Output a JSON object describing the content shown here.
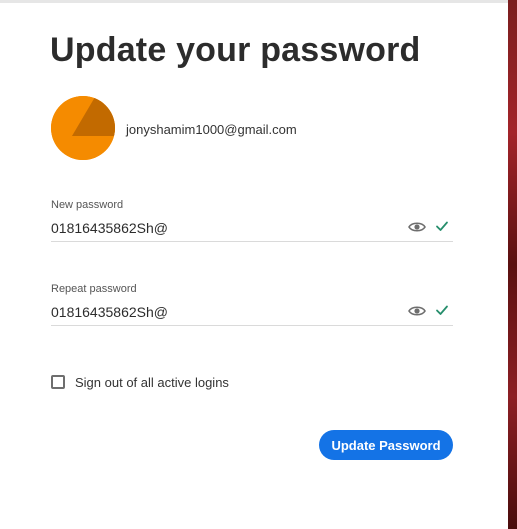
{
  "page": {
    "title": "Update your password"
  },
  "account": {
    "email": "jonyshamim1000@gmail.com",
    "avatar_color": "#f58b00"
  },
  "new_password": {
    "label": "New password",
    "value": "01816435862Sh@",
    "show_icon": "eye-icon",
    "valid_icon": "check-icon",
    "valid_color": "#268e6c"
  },
  "repeat_password": {
    "label": "Repeat password",
    "value": "01816435862Sh@",
    "show_icon": "eye-icon",
    "valid_icon": "check-icon",
    "valid_color": "#268e6c"
  },
  "sign_out": {
    "label": "Sign out of all active logins",
    "checked": false
  },
  "actions": {
    "update_label": "Update Password",
    "update_color": "#1473e6"
  }
}
